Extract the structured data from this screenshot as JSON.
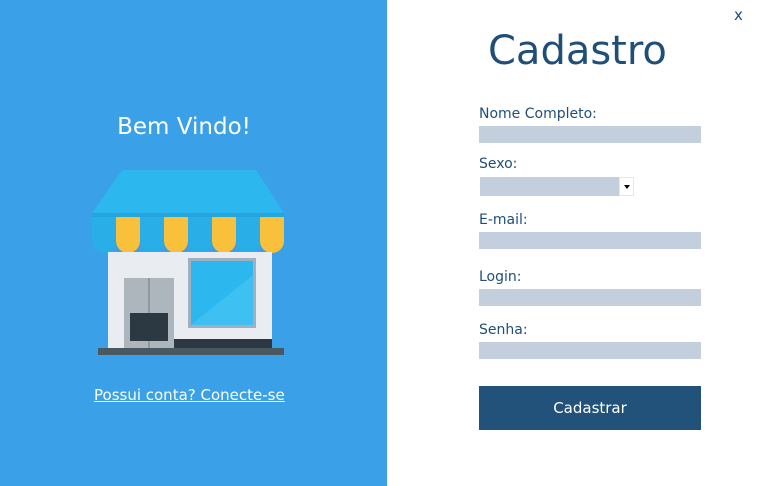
{
  "welcome_text": "Bem Vindo!",
  "login_link": "Possui conta? Conecte-se",
  "close_label": "x",
  "form": {
    "title": "Cadastro",
    "fields": {
      "nome": {
        "label": "Nome Completo:",
        "value": ""
      },
      "sexo": {
        "label": "Sexo:",
        "value": ""
      },
      "email": {
        "label": "E-mail:",
        "value": ""
      },
      "login": {
        "label": "Login:",
        "value": ""
      },
      "senha": {
        "label": "Senha:",
        "value": ""
      }
    },
    "submit_label": "Cadastrar"
  },
  "icons": {
    "store": "store-icon",
    "dropdown": "chevron-down-icon"
  },
  "colors": {
    "left_panel": "#3aa0e8",
    "primary": "#1f4e79",
    "button": "#22527a",
    "input_bg": "#c3cfdd"
  }
}
